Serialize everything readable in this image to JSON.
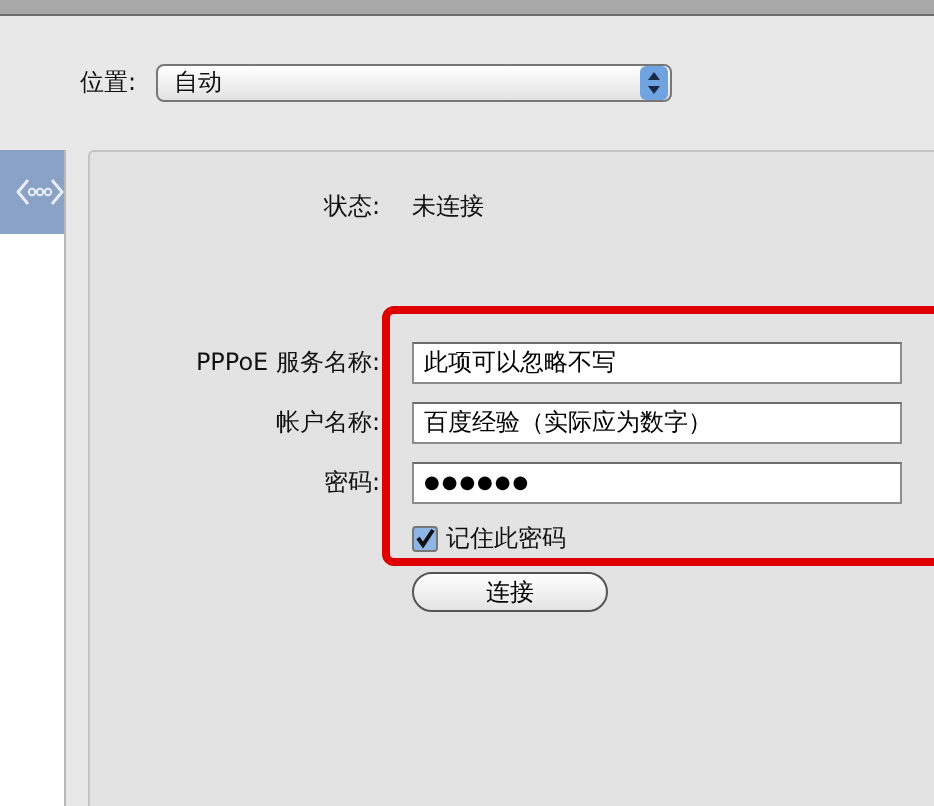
{
  "location": {
    "label": "位置:",
    "value": "自动"
  },
  "status": {
    "label": "状态:",
    "value": "未连接"
  },
  "fields": [
    {
      "label": "PPPoE 服务名称:",
      "value": "此项可以忽略不写",
      "kind": "text"
    },
    {
      "label": "帐户名称:",
      "value": "百度经验（实际应为数字）",
      "kind": "text"
    },
    {
      "label": "密码:",
      "value": "●●●●●●",
      "kind": "password"
    }
  ],
  "remember_password": {
    "label": "记住此密码",
    "checked": true
  },
  "connect_button": {
    "label": "连接"
  }
}
